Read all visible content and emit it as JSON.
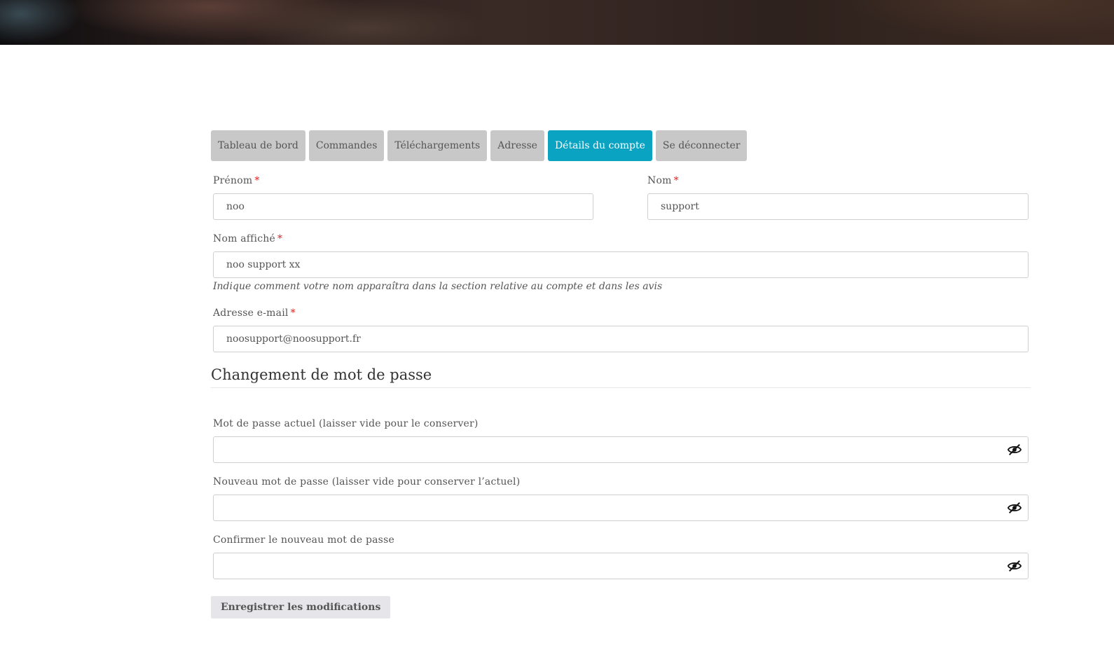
{
  "tabs": [
    {
      "label": "Tableau de bord",
      "active": false
    },
    {
      "label": "Commandes",
      "active": false
    },
    {
      "label": "Téléchargements",
      "active": false
    },
    {
      "label": "Adresse",
      "active": false
    },
    {
      "label": "Détails du compte",
      "active": true
    },
    {
      "label": "Se déconnecter",
      "active": false
    }
  ],
  "form": {
    "first_name": {
      "label": "Prénom",
      "required": "*",
      "value": "noo"
    },
    "last_name": {
      "label": "Nom",
      "required": "*",
      "value": "support"
    },
    "display_name": {
      "label": "Nom affiché",
      "required": "*",
      "value": "noo support xx",
      "hint": "Indique comment votre nom apparaîtra dans la section relative au compte et dans les avis"
    },
    "email": {
      "label": "Adresse e-mail",
      "required": "*",
      "value": "noosupport@noosupport.fr"
    }
  },
  "password_section": {
    "title": "Changement de mot de passe",
    "current": {
      "label": "Mot de passe actuel (laisser vide pour le conserver)",
      "value": "",
      "icon": "eye-slash-icon"
    },
    "new": {
      "label": "Nouveau mot de passe (laisser vide pour conserver l’actuel)",
      "value": "",
      "icon": "eye-slash-icon"
    },
    "confirm": {
      "label": "Confirmer le nouveau mot de passe",
      "value": "",
      "icon": "eye-slash-icon"
    }
  },
  "save_button": "Enregistrer les modifications",
  "colors": {
    "accent": "#0aa3c2",
    "required": "#e01e1e",
    "tab_bg": "#c8c8c8"
  }
}
